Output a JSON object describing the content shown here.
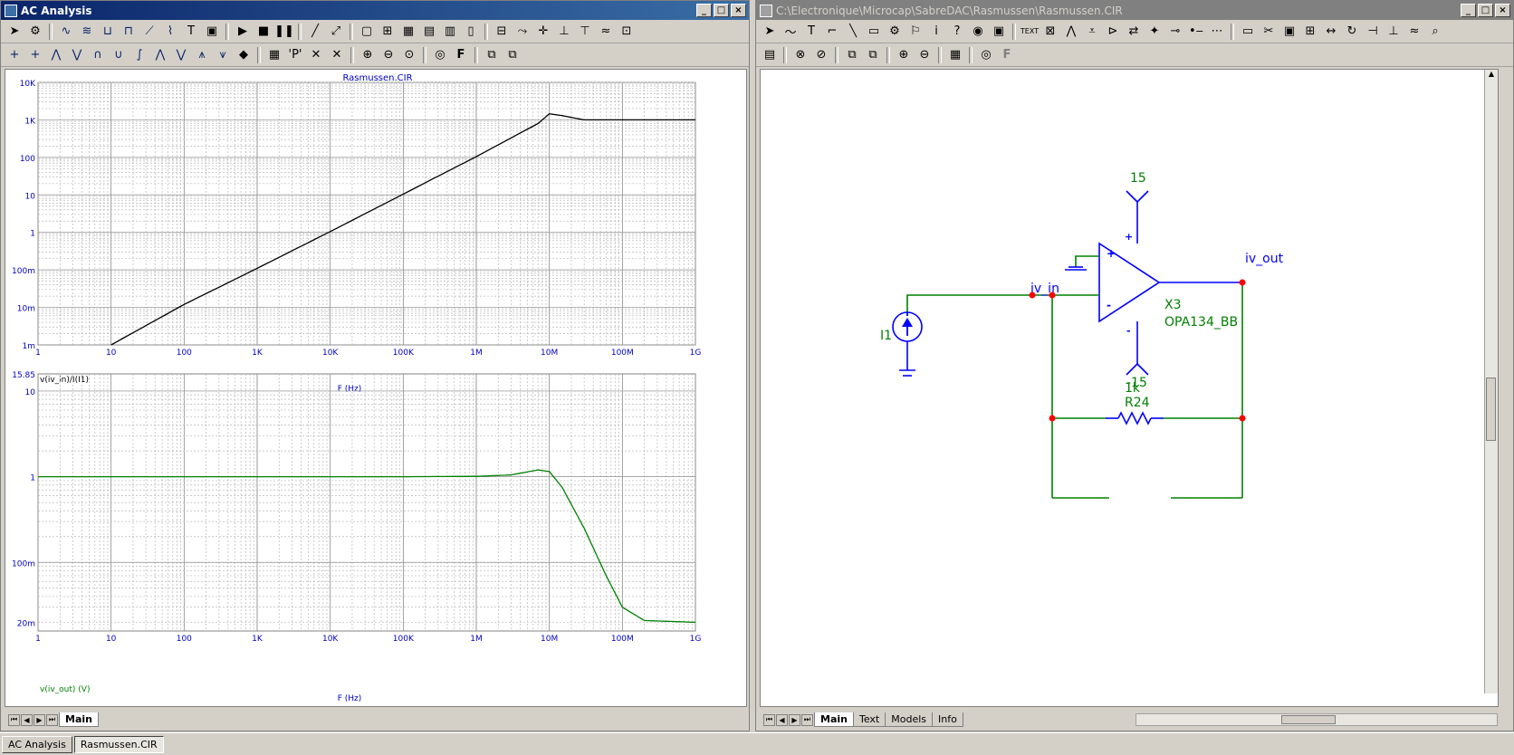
{
  "left_window": {
    "title": "AC Analysis",
    "tabs": [
      "Main"
    ],
    "plot1": {
      "title": "Rasmussen.CIR",
      "y_ticks": [
        "10K",
        "1K",
        "100",
        "10",
        "1",
        "100m",
        "10m",
        "1m"
      ],
      "x_ticks": [
        "1",
        "10",
        "100",
        "1K",
        "10K",
        "100K",
        "1M",
        "10M",
        "100M",
        "1G"
      ],
      "x_label": "F (Hz)",
      "y_expr": "v(iv_in)/I(I1)"
    },
    "plot2": {
      "y_ticks": [
        "15.85",
        "10",
        "1",
        "100m",
        "20m"
      ],
      "x_ticks": [
        "1",
        "10",
        "100",
        "1K",
        "10K",
        "100K",
        "1M",
        "10M",
        "100M",
        "1G"
      ],
      "x_label": "F (Hz)",
      "y_expr": "v(iv_out) (V)"
    }
  },
  "right_window": {
    "title": "C:\\Electronique\\Microcap\\SabreDAC\\Rasmussen\\Rasmussen.CIR",
    "tabs": [
      "Main",
      "Text",
      "Models",
      "Info"
    ],
    "schematic": {
      "vplus": "15",
      "vminus": "-15",
      "opamp_name": "X3",
      "opamp_model": "OPA134_BB",
      "node_in": "iv_in",
      "node_out": "iv_out",
      "source": "I1",
      "resistor_value": "1k",
      "resistor_name": "R24",
      "plus_sign": "+",
      "minus_sign": "-"
    }
  },
  "taskbar": {
    "items": [
      "AC Analysis",
      "Rasmussen.CIR"
    ]
  },
  "colors": {
    "title_active": "#0a246a",
    "wire": "#008000",
    "component": "#0000ff",
    "node_dot": "#ff0000",
    "trace1": "#000000",
    "trace2": "#008000"
  },
  "chart_data": [
    {
      "type": "line",
      "title": "Rasmussen.CIR",
      "xlabel": "F (Hz)",
      "ylabel": "v(iv_in)/I(I1)",
      "x_scale": "log",
      "y_scale": "log",
      "xlim": [
        1,
        1000000000
      ],
      "ylim": [
        0.001,
        10000
      ],
      "grid": true,
      "series": [
        {
          "name": "v(iv_in)/I(I1)",
          "color": "#000000",
          "x": [
            10,
            100,
            1000,
            10000,
            100000,
            1000000,
            7000000,
            10000000,
            15000000,
            30000000,
            100000000,
            1000000000
          ],
          "y": [
            0.001,
            0.012,
            0.11,
            1.05,
            10.5,
            105,
            800,
            1450,
            1300,
            1000,
            1000,
            1000
          ]
        }
      ]
    },
    {
      "type": "line",
      "xlabel": "F (Hz)",
      "ylabel": "v(iv_out) (V)",
      "x_scale": "log",
      "y_scale": "log",
      "xlim": [
        1,
        1000000000
      ],
      "ylim": [
        0.01585,
        15.85
      ],
      "grid": true,
      "series": [
        {
          "name": "v(iv_out) (V)",
          "color": "#008000",
          "x": [
            1,
            10,
            100,
            1000,
            100000,
            1000000,
            3000000,
            7000000,
            10000000,
            15000000,
            30000000,
            60000000,
            100000000,
            200000000,
            1000000000
          ],
          "y": [
            1,
            1,
            1,
            1,
            1,
            1.01,
            1.05,
            1.2,
            1.15,
            0.75,
            0.25,
            0.07,
            0.03,
            0.021,
            0.02
          ]
        }
      ]
    }
  ]
}
